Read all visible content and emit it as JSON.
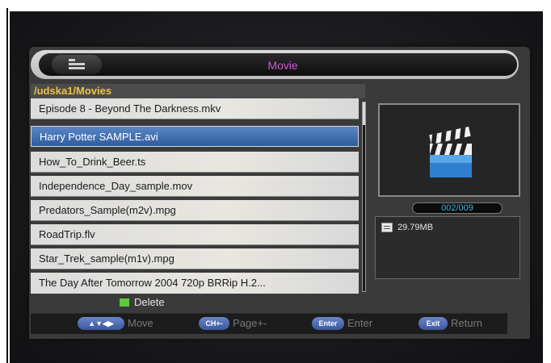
{
  "header": {
    "title": "Movie",
    "path": "/udska1/Movies"
  },
  "file_list": {
    "items": [
      "Episode 8 - Beyond The Darkness.mkv",
      "Harry Potter SAMPLE.avi",
      "How_To_Drink_Beer.ts",
      "Independence_Day_sample.mov",
      "Predators_Sample(m2v).mpg",
      "RoadTrip.flv",
      "Star_Trek_sample(m1v).mpg",
      "The Day After Tomorrow 2004 720p BRRip H.2..."
    ],
    "selected_index": 1
  },
  "preview": {
    "icon": "movie-clapperboard-icon",
    "counter": "002/009"
  },
  "info": {
    "file_size": "29.79MB",
    "file_size_icon": "document-icon"
  },
  "actions": {
    "delete_label": "Delete",
    "delete_key_color": "#5ecb3c"
  },
  "help": {
    "move_key": "▲▼◀▶",
    "move_label": "Move",
    "page_key": "CH+-",
    "page_label": "Page+-",
    "enter_key": "Enter",
    "enter_label": "Enter",
    "return_key": "Exit",
    "return_label": "Return"
  },
  "colors": {
    "title": "#d05ad0",
    "path": "#f0c04a",
    "selection": "#3a6aae",
    "counter_text": "#3fb8d8",
    "key_pill": "#4a68b0"
  }
}
